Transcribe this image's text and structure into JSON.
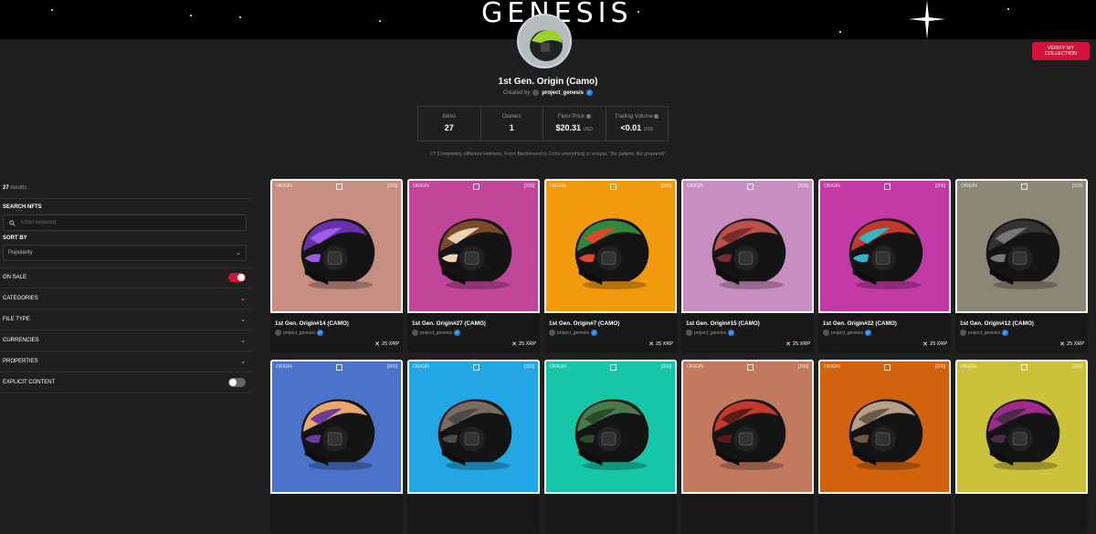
{
  "banner": {
    "title": "GENESIS"
  },
  "header_actions": {
    "verify_label": "VERIFY MY COLLECTION"
  },
  "collection": {
    "title": "1st Gen. Origin (Camo)",
    "created_by_label": "Created by",
    "creator": "project_genesis",
    "description": "27 Completely different Helmets. From Backround to Color everything is unique. \"Be patient, Be prepared\""
  },
  "stats": [
    {
      "label": "Items",
      "value": "27",
      "unit": ""
    },
    {
      "label": "Owners",
      "value": "1",
      "unit": ""
    },
    {
      "label": "Floor Price",
      "value": "$20.31",
      "unit": "USD"
    },
    {
      "label": "Trading Volume",
      "value": "<0.01",
      "unit": "USD"
    }
  ],
  "sidebar": {
    "results_count": "27",
    "results_label": "results",
    "search_label": "SEARCH NFTS",
    "search_placeholder": "Enter keyword",
    "sort_label": "SORT BY",
    "sort_value": "Popularity",
    "on_sale_label": "ON SALE",
    "on_sale": true,
    "categories_label": "CATEGORIES",
    "file_type_label": "FILE TYPE",
    "currencies_label": "CURRENCIES",
    "properties_label": "PROPERTIES",
    "explicit_label": "EXPLICIT CONTENT",
    "explicit": false
  },
  "art_labels": {
    "brand": "ORIGIN",
    "edition": "[200]"
  },
  "cards": [
    {
      "name": "1st Gen. Origin#14 (CAMO)",
      "creator": "project_genesis",
      "price": "25 XRP",
      "bg": "#c78f82",
      "camo1": "#6a2fb0",
      "camo2": "#9b5de5"
    },
    {
      "name": "1st Gen. Origin#27 (CAMO)",
      "creator": "project_genesis",
      "price": "25 XRP",
      "bg": "#c0469a",
      "camo1": "#7a4a2a",
      "camo2": "#e9d2b4"
    },
    {
      "name": "1st Gen. Origin#7 (CAMO)",
      "creator": "project_genesis",
      "price": "25 XRP",
      "bg": "#f29a0e",
      "camo1": "#2e8a3a",
      "camo2": "#d84a2a"
    },
    {
      "name": "1st Gen. Origin#15 (CAMO)",
      "creator": "project_genesis",
      "price": "25 XRP",
      "bg": "#c88ec2",
      "camo1": "#b8524a",
      "camo2": "#7a2a2a"
    },
    {
      "name": "1st Gen. Origin#22 (CAMO)",
      "creator": "project_genesis",
      "price": "25 XRP",
      "bg": "#c13aa5",
      "camo1": "#c0392b",
      "camo2": "#33b5c4"
    },
    {
      "name": "1st Gen. Origin#12 (CAMO)",
      "creator": "project_genesis",
      "price": "25 XRP",
      "bg": "#8a8777",
      "camo1": "#333333",
      "camo2": "#777777"
    },
    {
      "name": "",
      "creator": "",
      "price": "",
      "bg": "#4a73c9",
      "camo1": "#e8a86a",
      "camo2": "#6b3a9a"
    },
    {
      "name": "",
      "creator": "",
      "price": "",
      "bg": "#22a6e4",
      "camo1": "#7a6a62",
      "camo2": "#4a4a4a"
    },
    {
      "name": "",
      "creator": "",
      "price": "",
      "bg": "#17c6a6",
      "camo1": "#4a7a4a",
      "camo2": "#2a4a2a"
    },
    {
      "name": "",
      "creator": "",
      "price": "",
      "bg": "#c27a5e",
      "camo1": "#c0392b",
      "camo2": "#5a1a1a"
    },
    {
      "name": "",
      "creator": "",
      "price": "",
      "bg": "#d2630e",
      "camo1": "#b8a088",
      "camo2": "#6a5a4a"
    },
    {
      "name": "",
      "creator": "",
      "price": "",
      "bg": "#cbc13a",
      "camo1": "#a02a8a",
      "camo2": "#4a2a4a"
    }
  ],
  "colors": {
    "accent": "#d2143a",
    "verified": "#2a7de1",
    "background": "#1f1f1f"
  }
}
